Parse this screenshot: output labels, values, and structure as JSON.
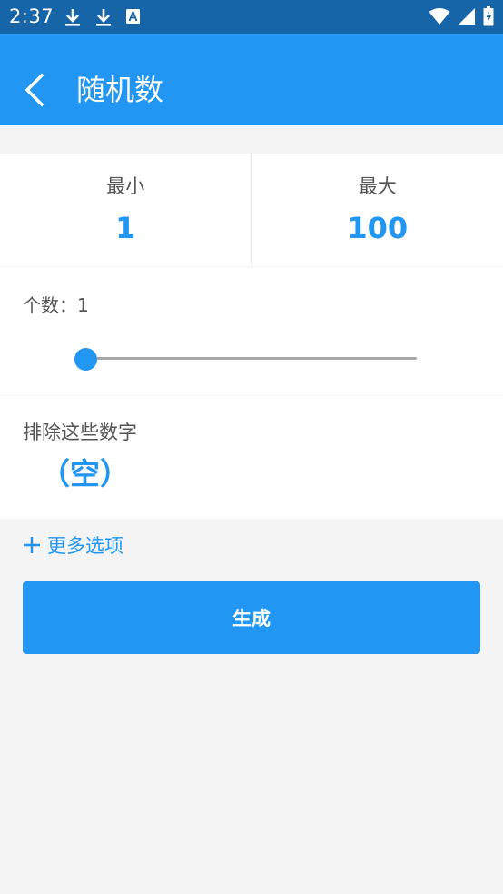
{
  "status_bar": {
    "time": "2:37",
    "left_icons": [
      "download-icon",
      "download-icon",
      "text-a-icon"
    ],
    "right_icons": [
      "wifi-icon",
      "cellular-icon",
      "battery-icon"
    ]
  },
  "app_bar": {
    "title": "随机数",
    "back_icon": "chevron-left-icon"
  },
  "range": {
    "min_label": "最小",
    "min_value": "1",
    "max_label": "最大",
    "max_value": "100"
  },
  "count": {
    "label": "个数：1",
    "slider_value": 1
  },
  "exclude": {
    "label": "排除这些数字",
    "value": "（空）"
  },
  "more_options": {
    "icon": "plus-icon",
    "label": "更多选项"
  },
  "generate_button": {
    "label": "生成"
  },
  "colors": {
    "accent": "#2196f3",
    "status_bar": "#1565a8",
    "background": "#f4f4f5"
  }
}
